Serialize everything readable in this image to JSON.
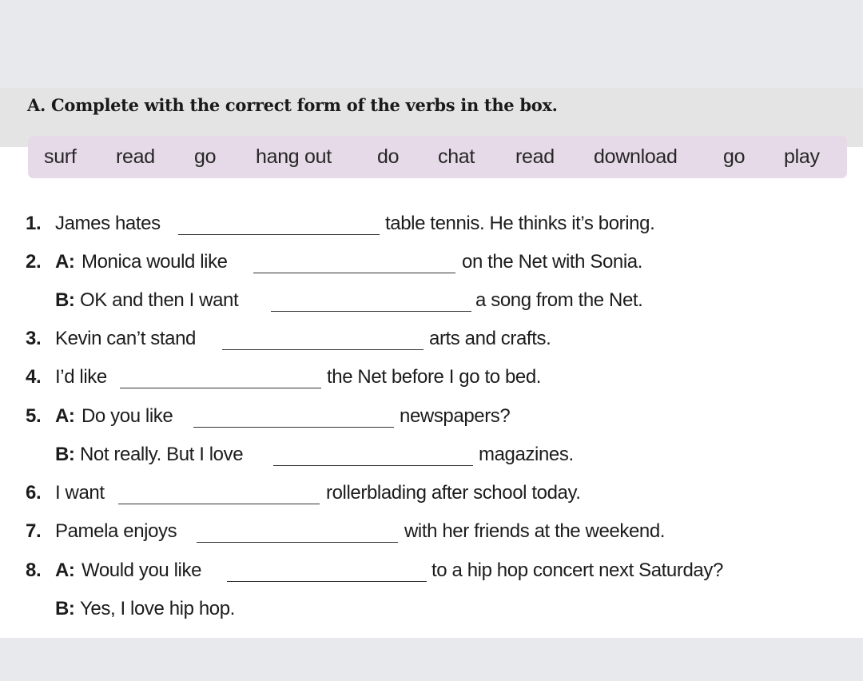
{
  "instruction": "A. Complete with the correct form of the verbs in the box.",
  "word_box": [
    "surf",
    "read",
    "go",
    "hang out",
    "do",
    "chat",
    "read",
    "download",
    "go",
    "play"
  ],
  "items": [
    {
      "number": "1.",
      "lines": [
        {
          "speaker": "",
          "before": "James hates",
          "after": "table tennis. He thinks it’s boring."
        }
      ]
    },
    {
      "number": "2.",
      "lines": [
        {
          "speaker": "A:",
          "before": "Monica would like",
          "after": "on the Net with Sonia."
        },
        {
          "speaker": "B:",
          "before": "OK and then I want",
          "after": "a song from the Net."
        }
      ]
    },
    {
      "number": "3.",
      "lines": [
        {
          "speaker": "",
          "before": "Kevin can’t stand",
          "after": "arts and crafts."
        }
      ]
    },
    {
      "number": "4.",
      "lines": [
        {
          "speaker": "",
          "before": "I’d like",
          "after": "the Net before I go to bed."
        }
      ]
    },
    {
      "number": "5.",
      "lines": [
        {
          "speaker": "A:",
          "before": "Do you like",
          "after": "newspapers?"
        },
        {
          "speaker": "B:",
          "before": "Not really. But I love",
          "after": "magazines."
        }
      ]
    },
    {
      "number": "6.",
      "lines": [
        {
          "speaker": "",
          "before": "I want",
          "after": "rollerblading after school today."
        }
      ]
    },
    {
      "number": "7.",
      "lines": [
        {
          "speaker": "",
          "before": "Pamela enjoys",
          "after": "with her friends at the weekend."
        }
      ]
    },
    {
      "number": "8.",
      "lines": [
        {
          "speaker": "A:",
          "before": "Would you like",
          "after": "to a hip hop concert next Saturday?"
        },
        {
          "speaker": "B:",
          "before": "Yes, I love hip hop.",
          "after": ""
        }
      ]
    }
  ]
}
